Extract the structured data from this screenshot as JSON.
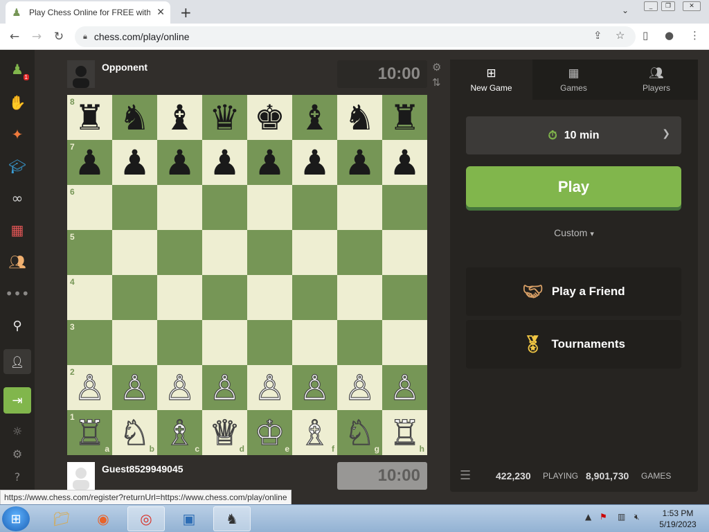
{
  "browser": {
    "tab_title": "Play Chess Online for FREE with F",
    "tab_favicon": "pawn-icon",
    "url": "chess.com/play/online",
    "status_url": "https://www.chess.com/register?returnUrl=https://www.chess.com/play/online"
  },
  "sidebar": {
    "items": [
      {
        "name": "play-icon",
        "badge": "1"
      },
      {
        "name": "puzzles-icon"
      },
      {
        "name": "learn-icon"
      },
      {
        "name": "lessons-icon"
      },
      {
        "name": "watch-icon"
      },
      {
        "name": "news-icon"
      },
      {
        "name": "social-icon"
      },
      {
        "name": "more-icon"
      },
      {
        "name": "search-icon"
      },
      {
        "name": "signup-icon"
      },
      {
        "name": "login-icon"
      },
      {
        "name": "theme-icon"
      },
      {
        "name": "settings-icon"
      },
      {
        "name": "help-icon"
      }
    ]
  },
  "game": {
    "opponent_name": "Opponent",
    "opponent_clock": "10:00",
    "player_name": "Guest8529949045",
    "player_clock": "10:00",
    "ranks": [
      "8",
      "7",
      "6",
      "5",
      "4",
      "3",
      "2",
      "1"
    ],
    "files": [
      "a",
      "b",
      "c",
      "d",
      "e",
      "f",
      "g",
      "h"
    ],
    "position": [
      [
        "♜",
        "♞",
        "♝",
        "♛",
        "♚",
        "♝",
        "♞",
        "♜"
      ],
      [
        "♟",
        "♟",
        "♟",
        "♟",
        "♟",
        "♟",
        "♟",
        "♟"
      ],
      [
        "",
        "",
        "",
        "",
        "",
        "",
        "",
        ""
      ],
      [
        "",
        "",
        "",
        "",
        "",
        "",
        "",
        ""
      ],
      [
        "",
        "",
        "",
        "",
        "",
        "",
        "",
        ""
      ],
      [
        "",
        "",
        "",
        "",
        "",
        "",
        "",
        ""
      ],
      [
        "♙",
        "♙",
        "♙",
        "♙",
        "♙",
        "♙",
        "♙",
        "♙"
      ],
      [
        "♖",
        "♘",
        "♗",
        "♕",
        "♔",
        "♗",
        "♘",
        "♖"
      ]
    ],
    "colors": {
      "light": "#eeeed2",
      "dark": "#769656"
    }
  },
  "panel": {
    "tabs": [
      {
        "label": "New Game",
        "icon": "plus-icon"
      },
      {
        "label": "Games",
        "icon": "board-icon"
      },
      {
        "label": "Players",
        "icon": "players-icon"
      }
    ],
    "time_control": "10 min",
    "play_label": "Play",
    "custom_label": "Custom",
    "play_friend_label": "Play a Friend",
    "tournaments_label": "Tournaments",
    "playing_count": "422,230",
    "playing_label": "PLAYING",
    "games_count": "8,901,730",
    "games_label": "GAMES",
    "accent": "#81b64c"
  },
  "taskbar": {
    "time": "1:53 PM",
    "date": "5/19/2023"
  }
}
